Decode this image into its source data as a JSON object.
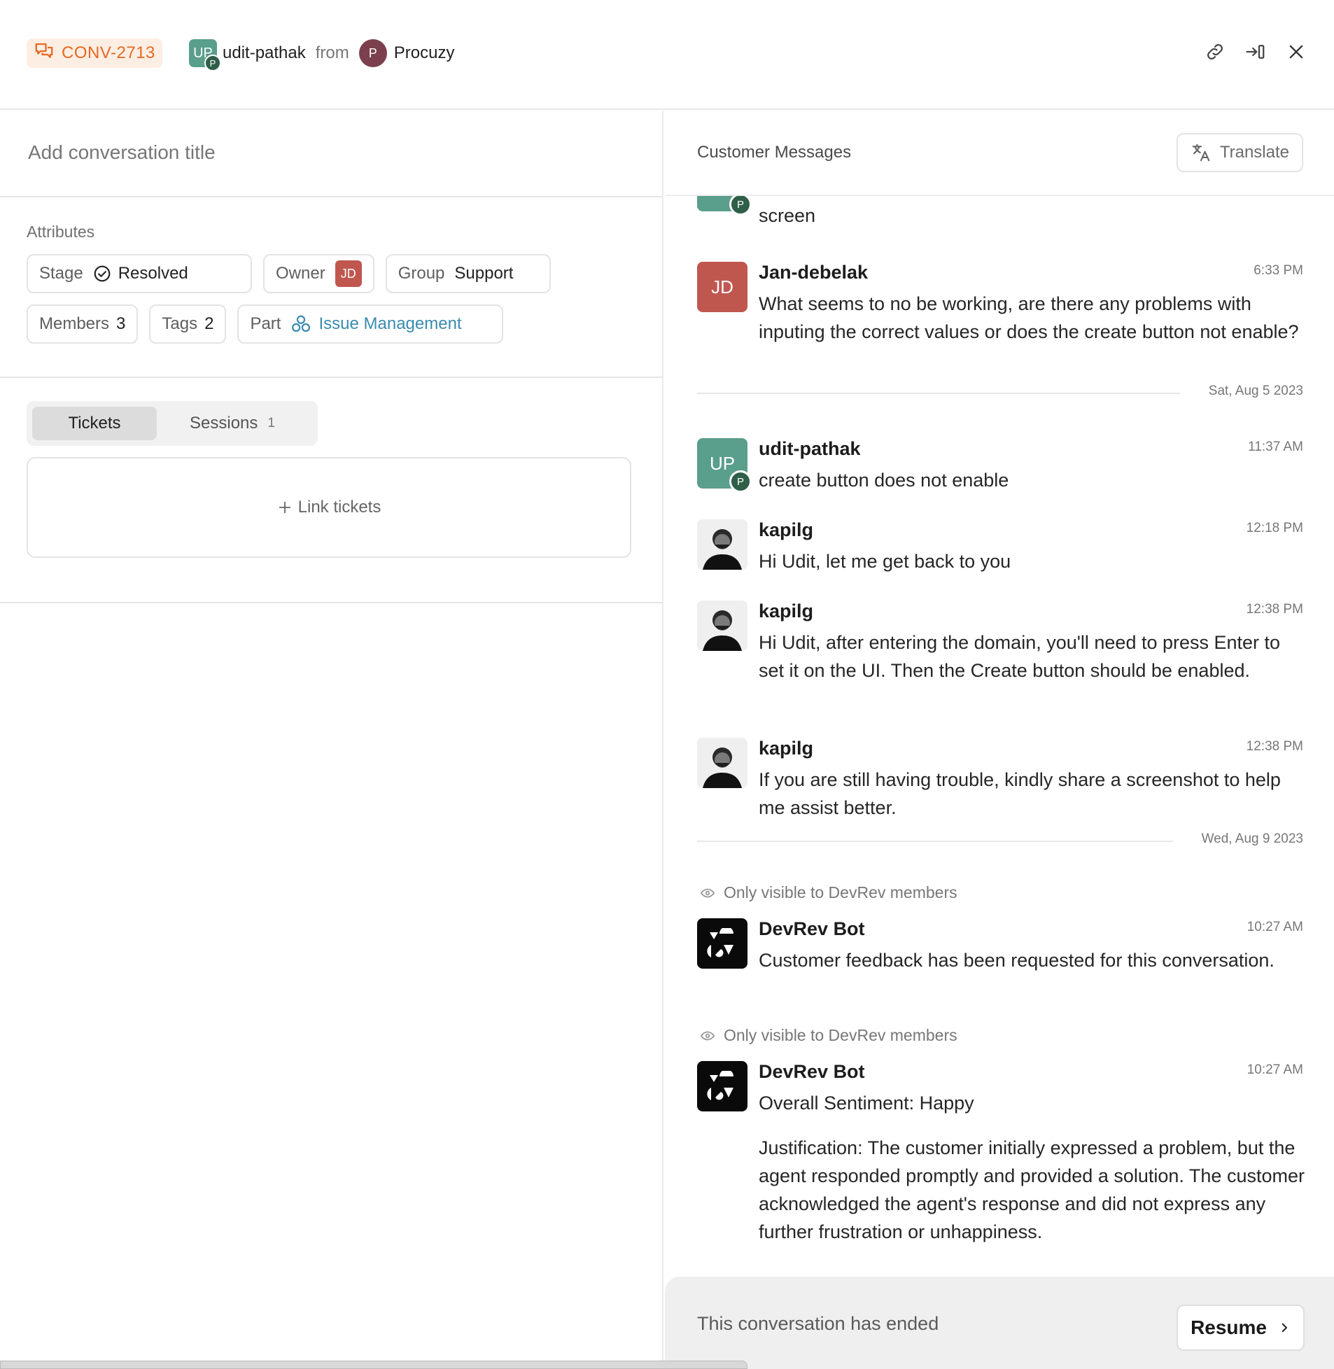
{
  "header": {
    "conv_id": "CONV-2713",
    "requester_initials": "UP",
    "requester_org_initial": "P",
    "requester_name": "udit-pathak",
    "from_label": "from",
    "org_initial": "P",
    "org_name": "Procuzy",
    "icons": [
      "link-icon",
      "move-to-panel-icon",
      "close-icon"
    ]
  },
  "left": {
    "title_placeholder": "Add conversation title",
    "attributes_label": "Attributes",
    "attributes": {
      "stage_key": "Stage",
      "stage_value": "Resolved",
      "owner_key": "Owner",
      "owner_initials": "JD",
      "group_key": "Group",
      "group_value": "Support",
      "members_key": "Members",
      "members_value": "3",
      "tags_key": "Tags",
      "tags_value": "2",
      "part_key": "Part",
      "part_value": "Issue Management"
    },
    "tabs": {
      "tickets": "Tickets",
      "sessions": "Sessions",
      "sessions_count": "1"
    },
    "link_tickets": "Link tickets"
  },
  "right": {
    "title": "Customer Messages",
    "translate_label": "Translate",
    "messages": [
      {
        "partial_text": "screen"
      },
      {
        "initials": "JD",
        "name": "Jan-debelak",
        "time": "6:33 PM",
        "text": "What seems to no be working, are there any problems with inputing the correct values or does the create button not enable?"
      },
      {
        "initials": "UP",
        "sub": "P",
        "name": "udit-pathak",
        "time": "11:37 AM",
        "text": "create button does not enable"
      },
      {
        "name": "kapilg",
        "time": "12:18 PM",
        "text": "Hi Udit, let me get back to you"
      },
      {
        "name": "kapilg",
        "time": "12:38 PM",
        "text": "Hi Udit, after entering the domain, you'll need to press Enter to set it on the UI. Then the Create button should be enabled."
      },
      {
        "name": "kapilg",
        "time": "12:38 PM",
        "text": "If you are still having trouble, kindly share a screenshot to help me assist better."
      },
      {
        "name": "DevRev Bot",
        "time": "10:27 AM",
        "text": "Customer feedback has been requested for this conversation."
      },
      {
        "name": "DevRev Bot",
        "time": "10:27 AM",
        "text": "Overall Sentiment: Happy",
        "text2": "Justification: The customer initially expressed a problem, but the agent responded promptly and provided a solution. The customer acknowledged the agent's response and did not express any further frustration or unhappiness."
      }
    ],
    "dates": [
      "Sat, Aug 5 2023",
      "Wed, Aug 9 2023"
    ],
    "visibility_note": "Only visible to DevRev members",
    "ended_text": "This conversation has ended",
    "resume_label": "Resume"
  },
  "colors": {
    "accent_orange": "#e46a22",
    "owner_red": "#c0574f",
    "user_green": "#5a9e8c",
    "link_blue": "#3a8bb0"
  }
}
